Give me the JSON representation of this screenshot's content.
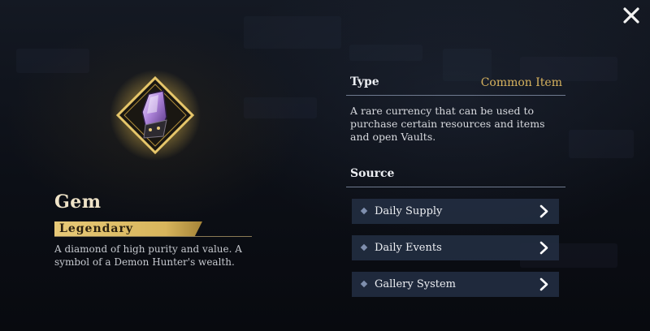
{
  "item": {
    "name": "Gem",
    "rarity": "Legendary",
    "description": "A diamond of high purity and value. A symbol of a Demon Hunter's wealth."
  },
  "details": {
    "type_label": "Type",
    "type_value": "Common Item",
    "type_description": "A rare currency that can be used to purchase certain resources and items and open Vaults.",
    "source_label": "Source",
    "sources": [
      "Daily Supply",
      "Daily Events",
      "Gallery System"
    ]
  },
  "icons": {
    "close": "close-icon",
    "item": "gem-icon",
    "row_arrow": "chevron-right-icon"
  },
  "colors": {
    "accent_gold": "#d6b25e",
    "rarity_legendary": "#e7c978",
    "row_background": "#222d40"
  }
}
